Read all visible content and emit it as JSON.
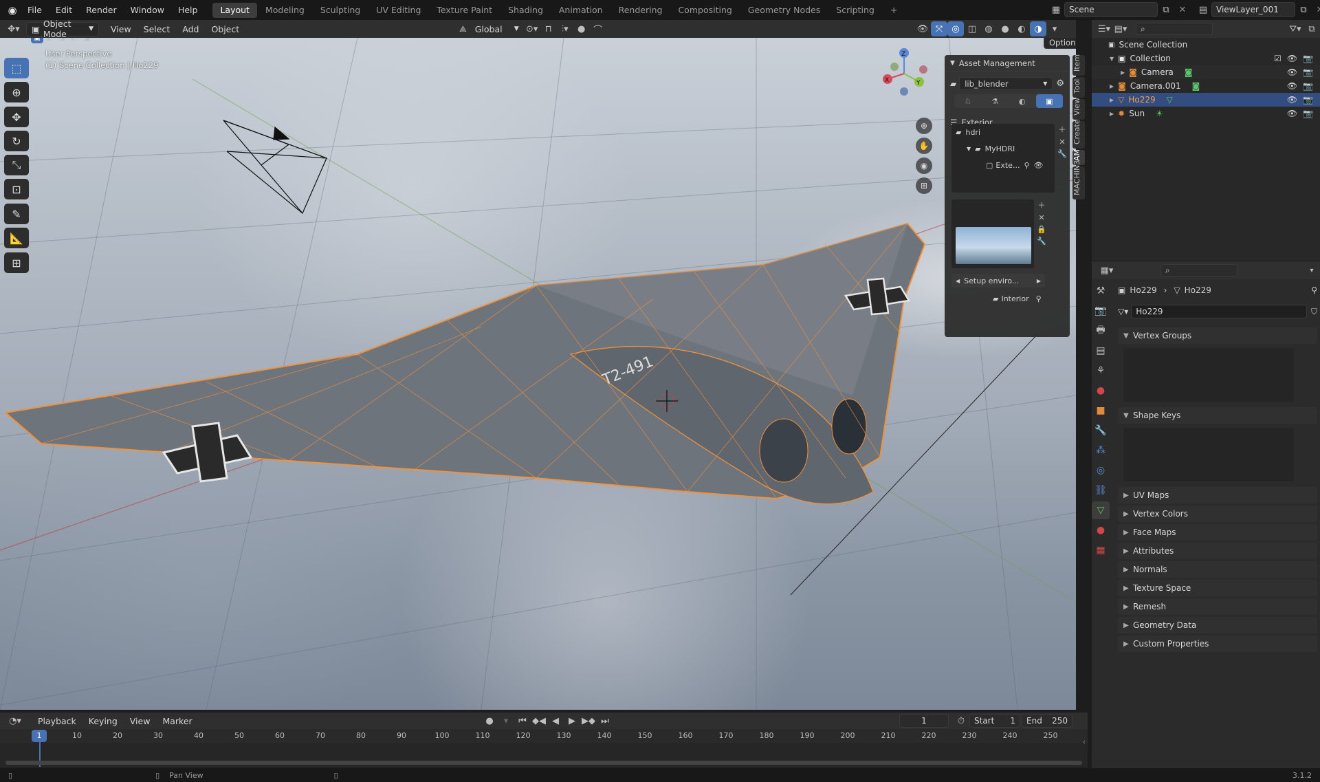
{
  "menu": [
    "File",
    "Edit",
    "Render",
    "Window",
    "Help"
  ],
  "workspaces": [
    "Layout",
    "Modeling",
    "Sculpting",
    "UV Editing",
    "Texture Paint",
    "Shading",
    "Animation",
    "Rendering",
    "Compositing",
    "Geometry Nodes",
    "Scripting"
  ],
  "active_workspace": "Layout",
  "add_workspace": "+",
  "scene": "Scene",
  "view_layer": "ViewLayer_001",
  "viewport_header": {
    "mode": "Object Mode",
    "menus": [
      "View",
      "Select",
      "Add",
      "Object"
    ],
    "orientation": "Global",
    "options": "Options"
  },
  "viewport": {
    "perspective": "User Perspective",
    "collection": "(1) Scene Collection | Ho229",
    "gizmo": {
      "x": "X",
      "y": "Y",
      "z": "Z"
    }
  },
  "asset_panel": {
    "title": "Asset Management",
    "library": "lib_blender",
    "category": "Exterior",
    "folder": "hdri",
    "subfolder": "MyHDRI",
    "item": "Exte...",
    "setup_button": "Setup enviro...",
    "interior": "Interior"
  },
  "sidebar_tabs": [
    "Item",
    "Tool",
    "View",
    "Create",
    "AM",
    "MACHIN3"
  ],
  "outliner": {
    "root": "Scene Collection",
    "items": [
      {
        "label": "Collection",
        "indent": 1,
        "icon": "collection-icon"
      },
      {
        "label": "Camera",
        "indent": 2,
        "icon": "camera-icon"
      },
      {
        "label": "Camera.001",
        "indent": 1,
        "icon": "camera-icon"
      },
      {
        "label": "Ho229",
        "indent": 1,
        "icon": "mesh-icon",
        "selected": true
      },
      {
        "label": "Sun",
        "indent": 1,
        "icon": "light-icon"
      }
    ]
  },
  "properties": {
    "breadcrumb_object": "Ho229",
    "breadcrumb_data": "Ho229",
    "data_name": "Ho229",
    "panels_open": [
      "Vertex Groups",
      "Shape Keys"
    ],
    "panels_closed": [
      "UV Maps",
      "Vertex Colors",
      "Face Maps",
      "Attributes",
      "Normals",
      "Texture Space",
      "Remesh",
      "Geometry Data",
      "Custom Properties"
    ]
  },
  "timeline": {
    "menus": [
      "Playback",
      "Keying",
      "View",
      "Marker"
    ],
    "current_frame": "1",
    "start_label": "Start",
    "start": "1",
    "end_label": "End",
    "end": "250",
    "ticks": [
      "10",
      "20",
      "30",
      "40",
      "50",
      "60",
      "70",
      "80",
      "90",
      "100",
      "110",
      "120",
      "130",
      "140",
      "150",
      "160",
      "170",
      "180",
      "190",
      "200",
      "210",
      "220",
      "230",
      "240",
      "250"
    ]
  },
  "status": {
    "hint": "Pan View",
    "version": "3.1.2"
  },
  "aircraft_marking": "T2-491",
  "colors": {
    "accent": "#4772b3",
    "selection": "#f0913c",
    "selected_row": "#334d80"
  }
}
